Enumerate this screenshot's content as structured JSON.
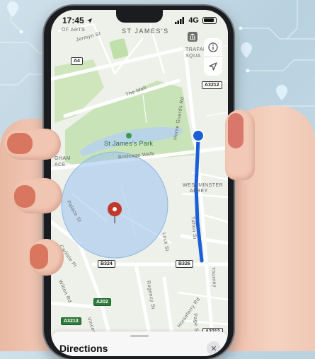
{
  "status_bar": {
    "time": "17:45",
    "carrier": "4G"
  },
  "map": {
    "labels": {
      "st_james_top": "ST JAMES'S",
      "jermyn": "Jermyn St",
      "of_arts": "OF ARTS",
      "trafalgar": "TRAFAL",
      "square": "SQUA",
      "the_mall": "The Mall",
      "park": "St James's Park",
      "birdcage": "Birdcage Walk",
      "horse_guards": "Horse Guards Rd",
      "westminster": "WESTMINSTER",
      "abbey": "ABBEY",
      "gham": "GHAM",
      "ace": "ACE",
      "palace_st": "Palace St",
      "carlisle": "Carlisle Pl",
      "tufton": "Tufton St",
      "lock": "Lock St",
      "thorney": "Thorney",
      "regency": "Regency St",
      "horseferry": "Horseferry Rd",
      "wilton": "Wilton Rd",
      "vincent": "Vincent Sq",
      "page": "Page St"
    },
    "shields": {
      "a4": "A4",
      "a3212": "A3212",
      "b324": "B324",
      "b326": "B326",
      "a202": "A202",
      "a3213": "A3213",
      "a3212b": "A3212"
    },
    "colors": {
      "route": "#1a5fd8",
      "pin": "#c0392b",
      "radius": "#9cc3ee",
      "park": "#c9e3b8"
    }
  },
  "sheet": {
    "title": "Directions",
    "close": "✕"
  },
  "icons": {
    "info": "info-icon",
    "locate": "location-arrow-icon",
    "poi": "museum-icon"
  }
}
